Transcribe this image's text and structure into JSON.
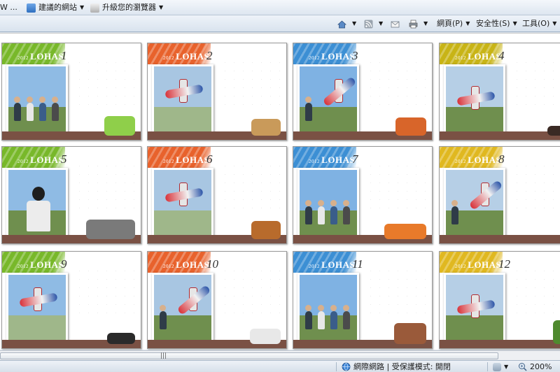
{
  "favorites_bar": {
    "truncated_label": "W ...",
    "suggested_sites_label": "建議的網站",
    "upgrade_browser_label": "升級您的瀏覽器"
  },
  "command_bar": {
    "page_menu_label": "網頁(P)",
    "safety_menu_label": "安全性(S)",
    "tools_menu_label": "工具(O)"
  },
  "calendar_brand": {
    "year": "2012",
    "name": "LOHAS"
  },
  "calendar_pages": [
    {
      "month": "1",
      "accent_color": "#78b82a",
      "scene": "group",
      "prop": "bag"
    },
    {
      "month": "2",
      "accent_color": "#e8622c",
      "scene": "plane-sky",
      "prop": "hat"
    },
    {
      "month": "3",
      "accent_color": "#3c8fd4",
      "scene": "person-plane",
      "prop": "food"
    },
    {
      "month": "4",
      "accent_color": "#c8b416",
      "scene": "plane-field",
      "prop": "sunglasses"
    },
    {
      "month": "5",
      "accent_color": "#78b82a",
      "scene": "portrait",
      "prop": "bicycle"
    },
    {
      "month": "6",
      "accent_color": "#e8622c",
      "scene": "plane-sky",
      "prop": "bread"
    },
    {
      "month": "7",
      "accent_color": "#3c8fd4",
      "scene": "group",
      "prop": "float-ring"
    },
    {
      "month": "8",
      "accent_color": "#e0b820",
      "scene": "person-plane",
      "prop": "starfish"
    },
    {
      "month": "9",
      "accent_color": "#78b82a",
      "scene": "plane-sky",
      "prop": "sandals"
    },
    {
      "month": "10",
      "accent_color": "#e8622c",
      "scene": "person-plane",
      "prop": "shoes"
    },
    {
      "month": "11",
      "accent_color": "#3c8fd4",
      "scene": "group",
      "prop": "chest"
    },
    {
      "month": "12",
      "accent_color": "#e0b820",
      "scene": "plane-field",
      "prop": "plant"
    }
  ],
  "status_bar": {
    "zone_label": "網際網路 | 受保護模式: 開閉",
    "zoom_label": "200%"
  },
  "icons": [
    "home-icon",
    "rss-feed-icon",
    "mail-icon",
    "print-icon",
    "suggested-sites-icon",
    "upgrade-browser-icon",
    "internet-zone-icon",
    "zoom-icon"
  ],
  "colors": {
    "brown_strip": "#7a5144",
    "toolbar_gradient_top": "#eef3f9",
    "toolbar_gradient_bottom": "#d9e3ee"
  }
}
